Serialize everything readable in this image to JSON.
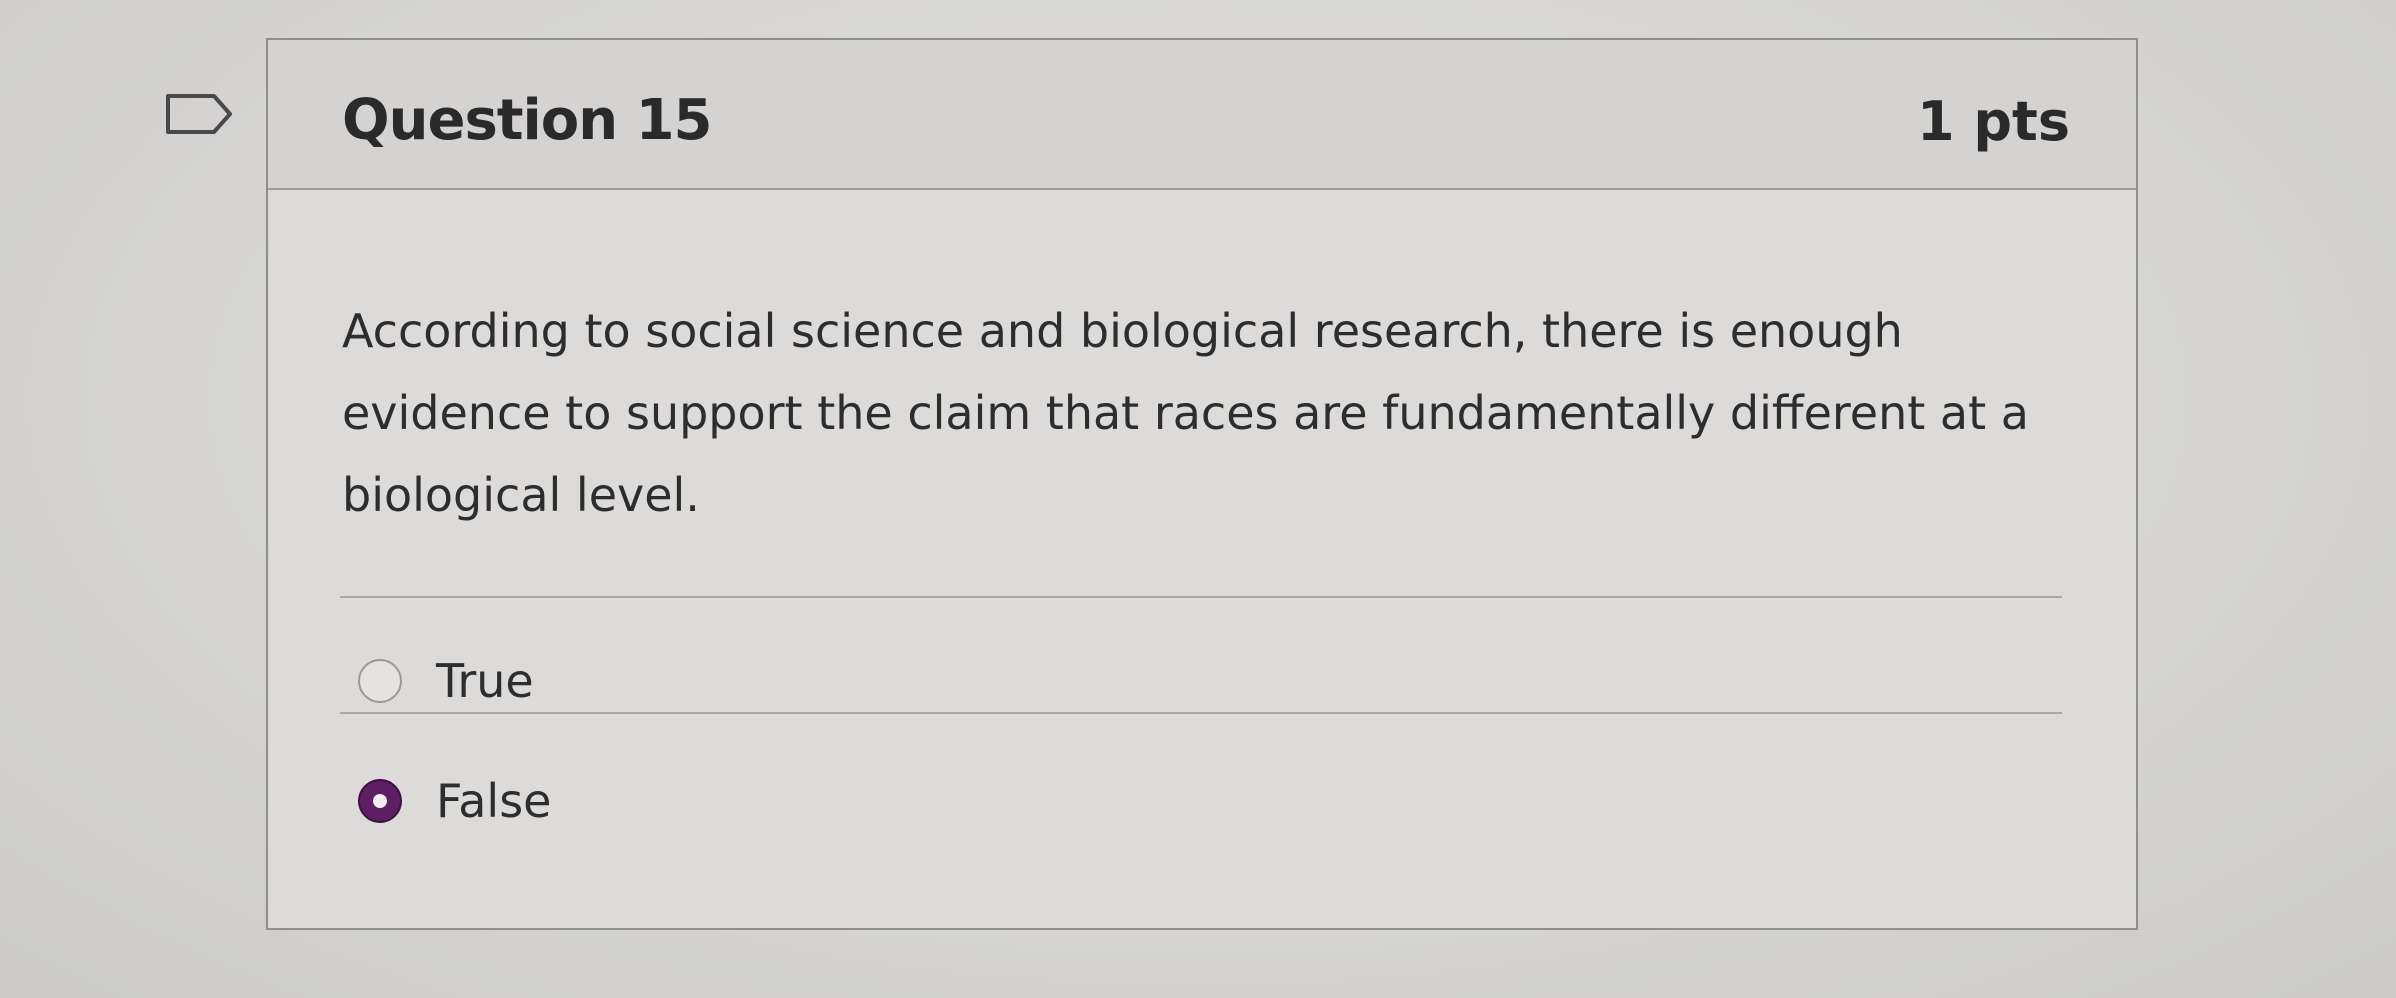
{
  "question": {
    "title": "Question 15",
    "points": "1 pts",
    "text": "According to social science and biological research, there is enough evidence to support the claim that races are fundamentally different at a biological level."
  },
  "answers": [
    {
      "label": "True",
      "selected": false
    },
    {
      "label": "False",
      "selected": true
    }
  ],
  "colors": {
    "selected_radio": "#5d1e63",
    "card_border": "#8f8e8c"
  },
  "icons": {
    "flag": "flag-question-icon"
  }
}
